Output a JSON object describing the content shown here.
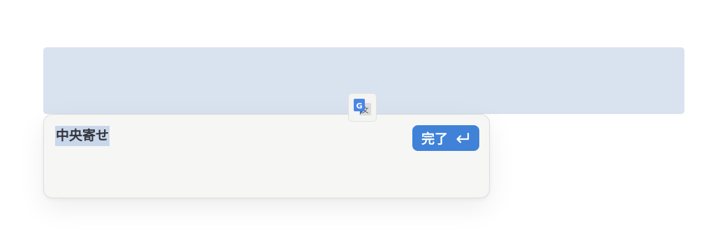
{
  "block": {
    "text": "中央寄せ"
  },
  "editor": {
    "text": "中央寄せ",
    "done_label": "完了"
  },
  "icons": {
    "translate": "google-translate-icon",
    "enter": "enter-return-icon"
  },
  "colors": {
    "block_background": "#d9e3ef",
    "editor_background": "#f6f6f5",
    "selection": "#c9d7ea",
    "done_button": "#3f82d8"
  }
}
